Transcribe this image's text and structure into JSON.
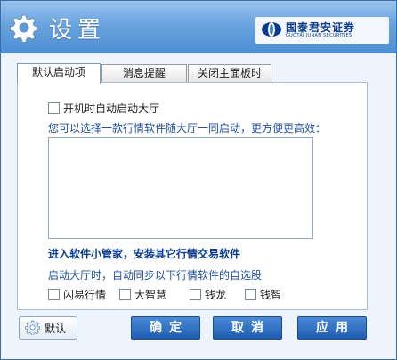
{
  "window": {
    "title": "设置"
  },
  "logo": {
    "name_cn": "国泰君安证券",
    "name_en": "GUOTAI JUNAN SECURITIES"
  },
  "tabs": [
    {
      "label": "默认启动项",
      "active": true
    },
    {
      "label": "消息提醒",
      "active": false
    },
    {
      "label": "关闭主面板时",
      "active": false
    }
  ],
  "startup": {
    "auto_start_label": "开机时自动启动大厅",
    "auto_start_checked": false,
    "choose_hint": "您可以选择一款行情软件随大厅一同启动，更方便更高效："
  },
  "manager": {
    "title": "进入软件小管家，安装其它行情交易软件",
    "sync_hint": "启动大厅时，自动同步以下行情软件的自选股",
    "software": [
      {
        "label": "闪易行情",
        "checked": false
      },
      {
        "label": "大智慧",
        "checked": false
      },
      {
        "label": "钱龙",
        "checked": false
      },
      {
        "label": "钱智",
        "checked": false
      }
    ]
  },
  "buttons": {
    "default": "默认",
    "ok": "确定",
    "cancel": "取消",
    "apply": "应用"
  },
  "icons": {
    "title_icon": "gear-icon",
    "default_icon": "gear-icon",
    "logo_icon": "logo-icon"
  },
  "colors": {
    "title_bar": "#5b9ade",
    "accent": "#1f5bb0",
    "hint_text": "#1f4f9a"
  }
}
